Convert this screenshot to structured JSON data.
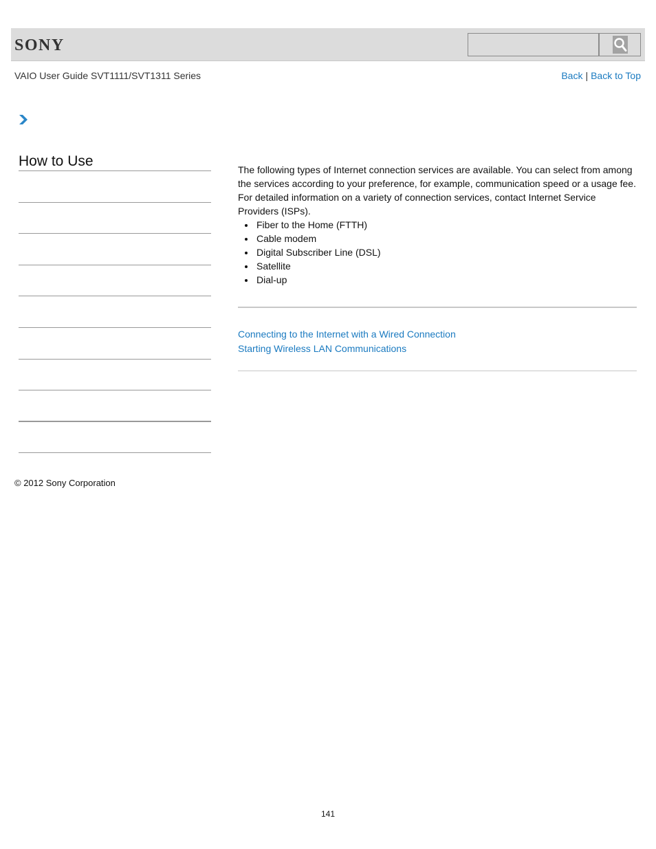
{
  "header": {
    "logo": "SONY",
    "search": {
      "value": "",
      "placeholder": ""
    }
  },
  "subheader": {
    "guide_title": "VAIO User Guide SVT1111/SVT1311 Series",
    "back_label": "Back",
    "separator": "|",
    "back_to_top_label": "Back to Top"
  },
  "sidebar": {
    "title": "How to Use",
    "items": [
      "",
      "",
      "",
      "",
      "",
      "",
      "",
      "",
      ""
    ]
  },
  "main": {
    "intro": "The following types of Internet connection services are available. You can select from among the services according to your preference, for example, communication speed or a usage fee. For detailed information on a variety of connection services, contact Internet Service Providers (ISPs).",
    "services": [
      "Fiber to the Home (FTTH)",
      "Cable modem",
      "Digital Subscriber Line (DSL)",
      "Satellite",
      "Dial-up"
    ],
    "related_links": [
      "Connecting to the Internet with a Wired Connection",
      "Starting Wireless LAN Communications"
    ]
  },
  "footer": {
    "copyright": "© 2012 Sony Corporation",
    "page_number": "141"
  },
  "colors": {
    "link": "#1a7ac0",
    "header_bg": "#dcdcdc",
    "divider": "#c8c8c8"
  }
}
